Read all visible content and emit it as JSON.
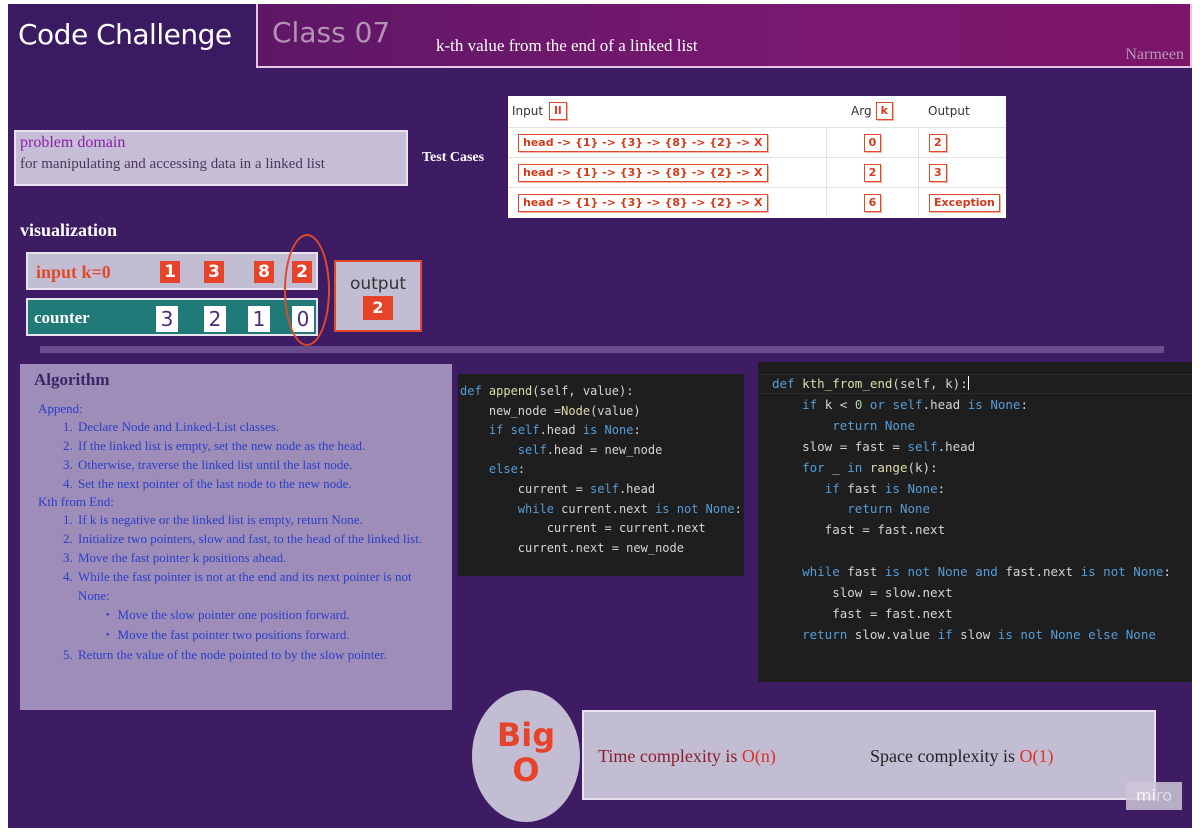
{
  "header": {
    "app_title": "Code Challenge",
    "class_label": "Class 07",
    "challenge_title": "k-th value from the end of a linked list",
    "author": "Narmeen"
  },
  "problem": {
    "title": "problem domain",
    "description": "for manipulating and accessing data in a linked list"
  },
  "test_cases": {
    "label": "Test Cases",
    "col_input": "Input",
    "col_input_tag": "ll",
    "col_arg": "Arg",
    "col_arg_tag": "k",
    "col_output": "Output",
    "rows": [
      {
        "input": "head -> {1} -> {3} -> {8} -> {2} -> X",
        "arg": "0",
        "output": "2"
      },
      {
        "input": "head -> {1} -> {3} -> {8} -> {2} -> X",
        "arg": "2",
        "output": "3"
      },
      {
        "input": "head -> {1} -> {3} -> {8} -> {2} -> X",
        "arg": "6",
        "output": "Exception"
      }
    ]
  },
  "visualization": {
    "title": "visualization",
    "input_label": "input k=0",
    "nodes": [
      "1",
      "3",
      "8",
      "2"
    ],
    "counter_label": "counter",
    "counters": [
      "3",
      "2",
      "1",
      "0"
    ],
    "output_label": "output",
    "output_value": "2"
  },
  "algorithm": {
    "title": "Algorithm",
    "append_heading": "Append:",
    "append_steps": [
      "Declare Node and   Linked-List classes.",
      "If the linked list is empty, set the new node as the head.",
      "Otherwise, traverse the linked list until the last node.",
      "Set the next pointer of the last node to the new node."
    ],
    "kth_heading": "Kth from End:",
    "kth_steps": [
      "If k is negative or the linked list is empty, return None.",
      "Initialize two pointers, slow and fast, to the head of the linked list.",
      "Move the fast pointer k positions ahead.",
      "While the fast pointer is not at the end and its next pointer is not None:"
    ],
    "kth_substeps": [
      "Move the slow pointer one position forward.",
      "Move the fast pointer two positions forward."
    ],
    "kth_last_step": "Return the value of the node pointed to by the slow pointer."
  },
  "complexity": {
    "big_o_line1": "Big",
    "big_o_line2": "O",
    "time_prefix": "Time complexity is ",
    "time_value": "O(n)",
    "space_prefix": "Space complexity  is ",
    "space_value": "O(1)"
  },
  "watermark": "miro"
}
